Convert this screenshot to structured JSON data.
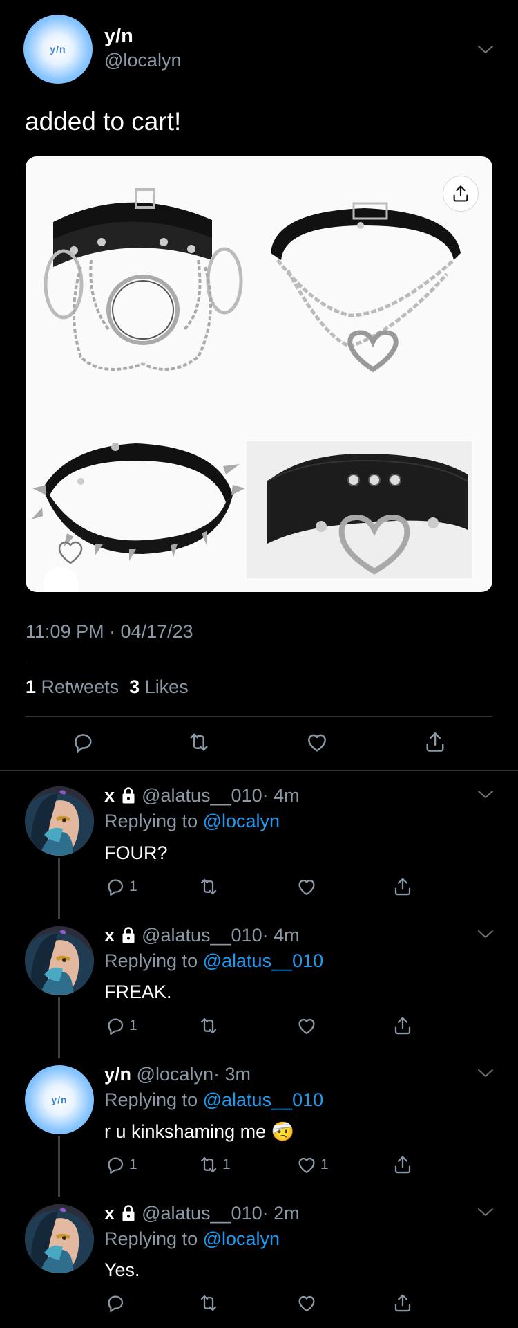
{
  "main_tweet": {
    "avatar_text": "y/n",
    "name": "y/n",
    "handle": "@localyn",
    "text": "added to cart!",
    "timestamp": "11:09 PM · 04/17/23",
    "retweets_count": "1",
    "retweets_label": "Retweets",
    "likes_count": "3",
    "likes_label": "Likes"
  },
  "replies": [
    {
      "name": "x",
      "handle": "@alatus__010",
      "time": "· 4m",
      "replying_label": "Replying to",
      "replying_to": "@localyn",
      "text": "FOUR?",
      "reply_count": "1",
      "retweet_count": "",
      "like_count": ""
    },
    {
      "name": "x",
      "handle": "@alatus__010",
      "time": "· 4m",
      "replying_label": "Replying to",
      "replying_to": "@alatus__010",
      "text": "FREAK.",
      "reply_count": "1",
      "retweet_count": "",
      "like_count": ""
    },
    {
      "name": "y/n",
      "avatar_text": "y/n",
      "handle": "@localyn",
      "time": "· 3m",
      "replying_label": "Replying to",
      "replying_to": "@alatus__010",
      "text": "r u kinkshaming me 🤕",
      "reply_count": "1",
      "retweet_count": "1",
      "like_count": "1"
    },
    {
      "name": "x",
      "handle": "@alatus__010",
      "time": "· 2m",
      "replying_label": "Replying to",
      "replying_to": "@localyn",
      "text": "Yes.",
      "reply_count": "",
      "retweet_count": "",
      "like_count": ""
    }
  ],
  "colors": {
    "background": "#000000",
    "secondary_text": "#8b98a5",
    "link": "#1d9bf0",
    "divider": "#2f3336"
  },
  "icons": [
    "chevron-down-icon",
    "reply-icon",
    "retweet-icon",
    "like-icon",
    "share-icon",
    "lock-icon",
    "heart-outline-icon"
  ]
}
